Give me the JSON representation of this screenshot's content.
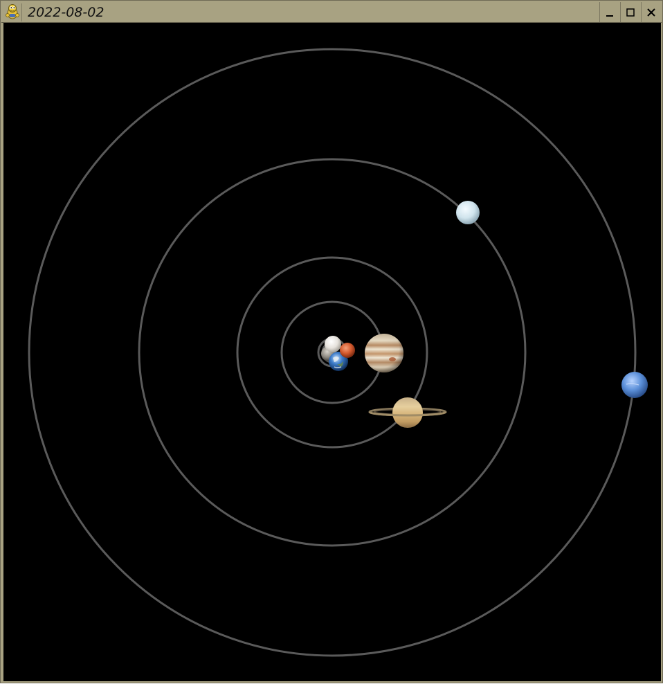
{
  "window": {
    "title": "2022-08-02",
    "app_icon": "python-snake-icon",
    "controls": {
      "minimize_icon": "minimize-icon",
      "maximize_icon": "maximize-icon",
      "close_icon": "close-icon"
    }
  },
  "scene": {
    "background_color": "#000000",
    "orbit_color": "#5a5a5a",
    "bodies": [
      "mercury",
      "venus",
      "earth",
      "mars",
      "jupiter",
      "saturn",
      "uranus",
      "neptune"
    ]
  }
}
